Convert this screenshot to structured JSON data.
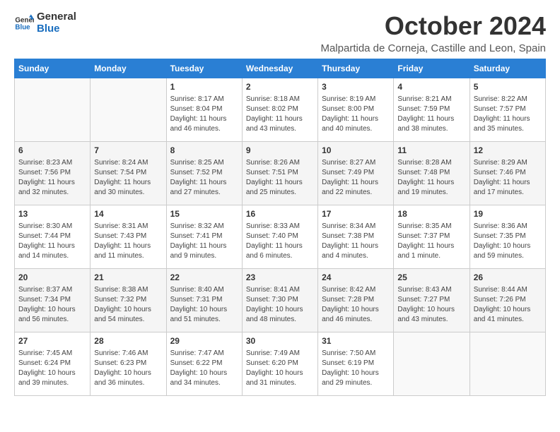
{
  "logo": {
    "line1": "General",
    "line2": "Blue"
  },
  "title": "October 2024",
  "subtitle": "Malpartida de Corneja, Castille and Leon, Spain",
  "weekdays": [
    "Sunday",
    "Monday",
    "Tuesday",
    "Wednesday",
    "Thursday",
    "Friday",
    "Saturday"
  ],
  "weeks": [
    [
      {
        "day": "",
        "content": ""
      },
      {
        "day": "",
        "content": ""
      },
      {
        "day": "1",
        "content": "Sunrise: 8:17 AM\nSunset: 8:04 PM\nDaylight: 11 hours and 46 minutes."
      },
      {
        "day": "2",
        "content": "Sunrise: 8:18 AM\nSunset: 8:02 PM\nDaylight: 11 hours and 43 minutes."
      },
      {
        "day": "3",
        "content": "Sunrise: 8:19 AM\nSunset: 8:00 PM\nDaylight: 11 hours and 40 minutes."
      },
      {
        "day": "4",
        "content": "Sunrise: 8:21 AM\nSunset: 7:59 PM\nDaylight: 11 hours and 38 minutes."
      },
      {
        "day": "5",
        "content": "Sunrise: 8:22 AM\nSunset: 7:57 PM\nDaylight: 11 hours and 35 minutes."
      }
    ],
    [
      {
        "day": "6",
        "content": "Sunrise: 8:23 AM\nSunset: 7:56 PM\nDaylight: 11 hours and 32 minutes."
      },
      {
        "day": "7",
        "content": "Sunrise: 8:24 AM\nSunset: 7:54 PM\nDaylight: 11 hours and 30 minutes."
      },
      {
        "day": "8",
        "content": "Sunrise: 8:25 AM\nSunset: 7:52 PM\nDaylight: 11 hours and 27 minutes."
      },
      {
        "day": "9",
        "content": "Sunrise: 8:26 AM\nSunset: 7:51 PM\nDaylight: 11 hours and 25 minutes."
      },
      {
        "day": "10",
        "content": "Sunrise: 8:27 AM\nSunset: 7:49 PM\nDaylight: 11 hours and 22 minutes."
      },
      {
        "day": "11",
        "content": "Sunrise: 8:28 AM\nSunset: 7:48 PM\nDaylight: 11 hours and 19 minutes."
      },
      {
        "day": "12",
        "content": "Sunrise: 8:29 AM\nSunset: 7:46 PM\nDaylight: 11 hours and 17 minutes."
      }
    ],
    [
      {
        "day": "13",
        "content": "Sunrise: 8:30 AM\nSunset: 7:44 PM\nDaylight: 11 hours and 14 minutes."
      },
      {
        "day": "14",
        "content": "Sunrise: 8:31 AM\nSunset: 7:43 PM\nDaylight: 11 hours and 11 minutes."
      },
      {
        "day": "15",
        "content": "Sunrise: 8:32 AM\nSunset: 7:41 PM\nDaylight: 11 hours and 9 minutes."
      },
      {
        "day": "16",
        "content": "Sunrise: 8:33 AM\nSunset: 7:40 PM\nDaylight: 11 hours and 6 minutes."
      },
      {
        "day": "17",
        "content": "Sunrise: 8:34 AM\nSunset: 7:38 PM\nDaylight: 11 hours and 4 minutes."
      },
      {
        "day": "18",
        "content": "Sunrise: 8:35 AM\nSunset: 7:37 PM\nDaylight: 11 hours and 1 minute."
      },
      {
        "day": "19",
        "content": "Sunrise: 8:36 AM\nSunset: 7:35 PM\nDaylight: 10 hours and 59 minutes."
      }
    ],
    [
      {
        "day": "20",
        "content": "Sunrise: 8:37 AM\nSunset: 7:34 PM\nDaylight: 10 hours and 56 minutes."
      },
      {
        "day": "21",
        "content": "Sunrise: 8:38 AM\nSunset: 7:32 PM\nDaylight: 10 hours and 54 minutes."
      },
      {
        "day": "22",
        "content": "Sunrise: 8:40 AM\nSunset: 7:31 PM\nDaylight: 10 hours and 51 minutes."
      },
      {
        "day": "23",
        "content": "Sunrise: 8:41 AM\nSunset: 7:30 PM\nDaylight: 10 hours and 48 minutes."
      },
      {
        "day": "24",
        "content": "Sunrise: 8:42 AM\nSunset: 7:28 PM\nDaylight: 10 hours and 46 minutes."
      },
      {
        "day": "25",
        "content": "Sunrise: 8:43 AM\nSunset: 7:27 PM\nDaylight: 10 hours and 43 minutes."
      },
      {
        "day": "26",
        "content": "Sunrise: 8:44 AM\nSunset: 7:26 PM\nDaylight: 10 hours and 41 minutes."
      }
    ],
    [
      {
        "day": "27",
        "content": "Sunrise: 7:45 AM\nSunset: 6:24 PM\nDaylight: 10 hours and 39 minutes."
      },
      {
        "day": "28",
        "content": "Sunrise: 7:46 AM\nSunset: 6:23 PM\nDaylight: 10 hours and 36 minutes."
      },
      {
        "day": "29",
        "content": "Sunrise: 7:47 AM\nSunset: 6:22 PM\nDaylight: 10 hours and 34 minutes."
      },
      {
        "day": "30",
        "content": "Sunrise: 7:49 AM\nSunset: 6:20 PM\nDaylight: 10 hours and 31 minutes."
      },
      {
        "day": "31",
        "content": "Sunrise: 7:50 AM\nSunset: 6:19 PM\nDaylight: 10 hours and 29 minutes."
      },
      {
        "day": "",
        "content": ""
      },
      {
        "day": "",
        "content": ""
      }
    ]
  ]
}
